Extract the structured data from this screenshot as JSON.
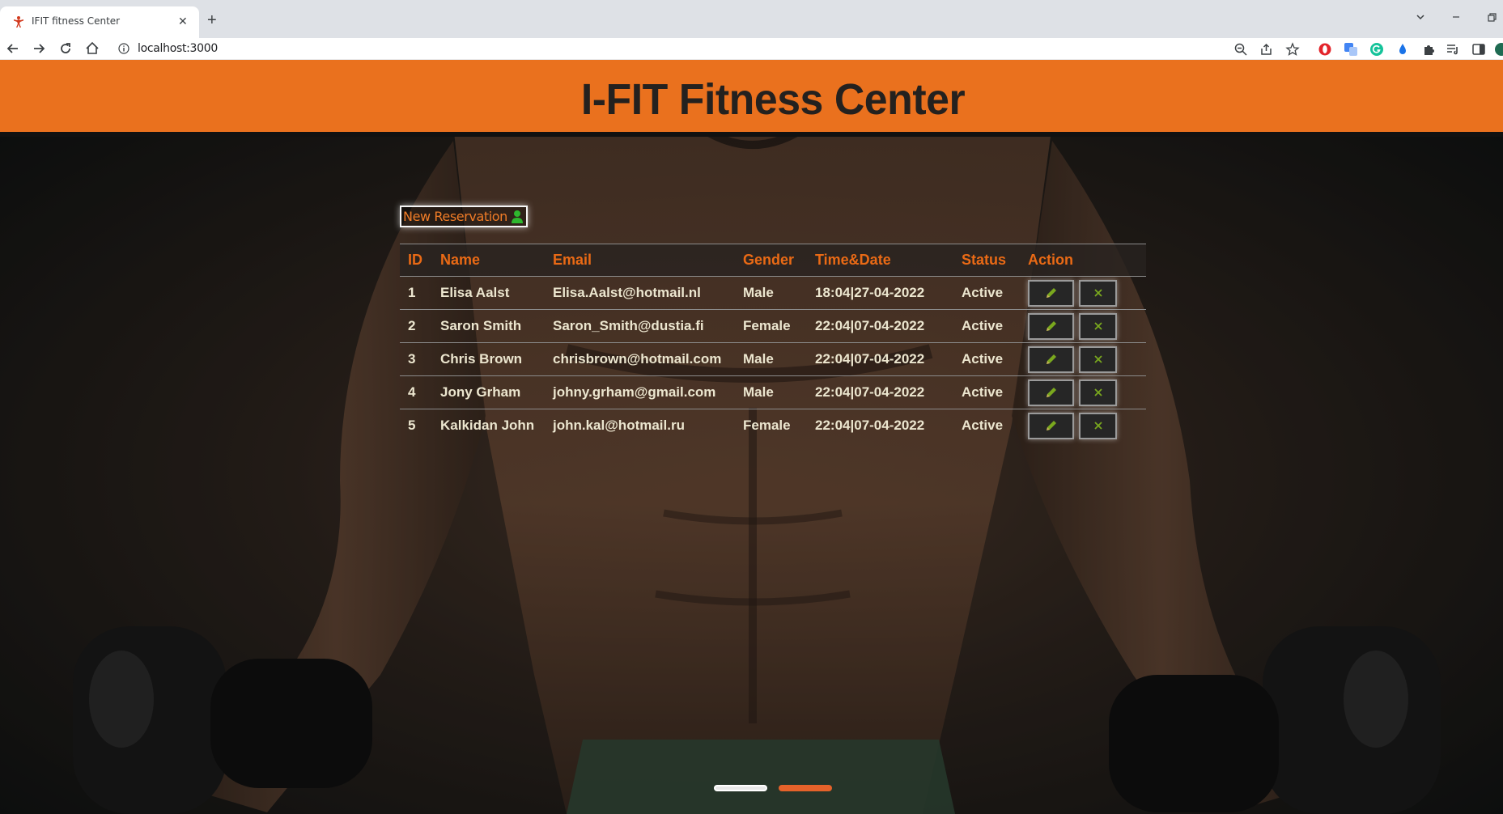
{
  "browser": {
    "tab_title": "IFIT fitness Center",
    "tab_close": "✕",
    "new_tab": "+",
    "url": "localhost:3000"
  },
  "header": {
    "title": "I-FIT Fitness Center",
    "color": "#ea711e"
  },
  "actions": {
    "new_reservation_label": "New Reservation"
  },
  "table": {
    "columns": [
      "ID",
      "Name",
      "Email",
      "Gender",
      "Time&Date",
      "Status",
      "Action"
    ],
    "rows": [
      {
        "id": "1",
        "name": "Elisa Aalst",
        "email": "Elisa.Aalst@hotmail.nl",
        "gender": "Male",
        "datetime": "18:04|27-04-2022",
        "status": "Active"
      },
      {
        "id": "2",
        "name": "Saron Smith",
        "email": "Saron_Smith@dustia.fi",
        "gender": "Female",
        "datetime": "22:04|07-04-2022",
        "status": "Active"
      },
      {
        "id": "3",
        "name": "Chris Brown",
        "email": "chrisbrown@hotmail.com",
        "gender": "Male",
        "datetime": "22:04|07-04-2022",
        "status": "Active"
      },
      {
        "id": "4",
        "name": "Jony Grham",
        "email": "johny.grham@gmail.com",
        "gender": "Male",
        "datetime": "22:04|07-04-2022",
        "status": "Active"
      },
      {
        "id": "5",
        "name": "Kalkidan John",
        "email": "john.kal@hotmail.ru",
        "gender": "Female",
        "datetime": "22:04|07-04-2022",
        "status": "Active"
      }
    ],
    "edit_icon": "pencil-icon",
    "delete_icon": "close-icon"
  },
  "carousel": {
    "active_index": 1,
    "count": 2
  }
}
